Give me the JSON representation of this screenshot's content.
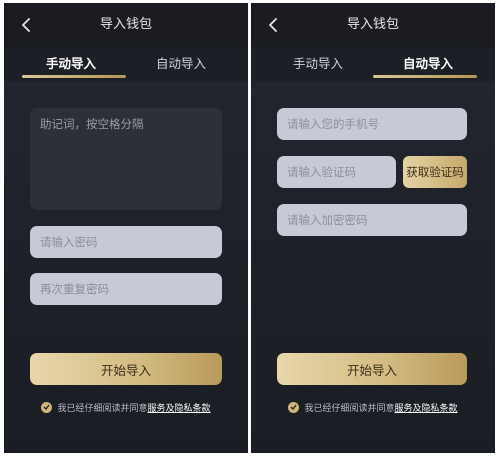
{
  "header": {
    "title": "导入钱包"
  },
  "tabs": {
    "manual": "手动导入",
    "auto": "自动导入"
  },
  "manual": {
    "mnemonic_placeholder": "助记词，按空格分隔",
    "password_placeholder": "请输入密码",
    "repeat_password_placeholder": "再次重复密码",
    "start_button": "开始导入"
  },
  "auto": {
    "phone_placeholder": "请输入您的手机号",
    "code_placeholder": "请输入验证码",
    "get_code_button": "获取验证码",
    "encrypt_password_placeholder": "请输入加密密码",
    "start_button": "开始导入"
  },
  "agreement": {
    "text": "我已经仔细阅读并同意",
    "link": "服务及隐私条款"
  },
  "colors": {
    "accent_gold": "#d4bd84",
    "background": "#1f222a",
    "input_light": "#c7cad6"
  }
}
